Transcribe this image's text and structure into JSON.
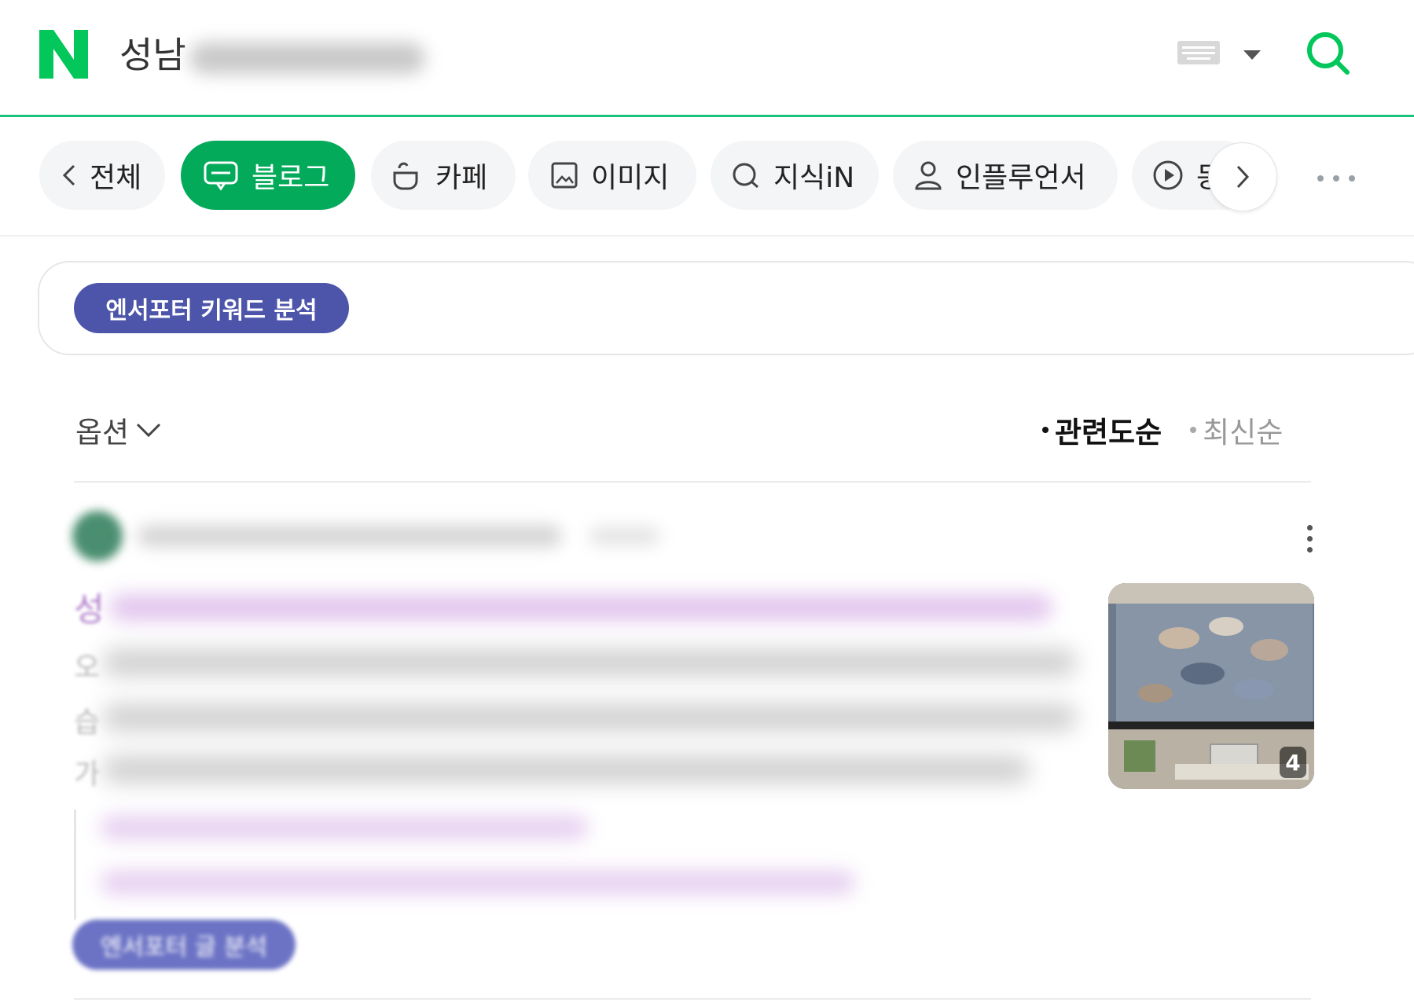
{
  "brand": {
    "logo_letter": "N",
    "accent_color": "#03aa5a"
  },
  "search": {
    "query_visible": "성남"
  },
  "tabs": [
    {
      "label": "전체",
      "icon": "chevron-left-icon"
    },
    {
      "label": "블로그",
      "icon": "blog-icon",
      "active": true
    },
    {
      "label": "카페",
      "icon": "cafe-icon"
    },
    {
      "label": "이미지",
      "icon": "image-icon"
    },
    {
      "label": "지식iN",
      "icon": "kin-icon"
    },
    {
      "label": "인플루언서",
      "icon": "person-icon"
    },
    {
      "label": "동",
      "icon": "play-icon"
    }
  ],
  "extension": {
    "keyword_button": "엔서포터 키워드 분석",
    "post_button": "엔서포터 글 분석"
  },
  "options": {
    "label": "옵션"
  },
  "sort": {
    "relevance": "관련도순",
    "latest": "최신순"
  },
  "result": {
    "title_start": "성",
    "snippet_starts": [
      "오",
      "습",
      "가"
    ],
    "thumbnail_count": "4"
  }
}
